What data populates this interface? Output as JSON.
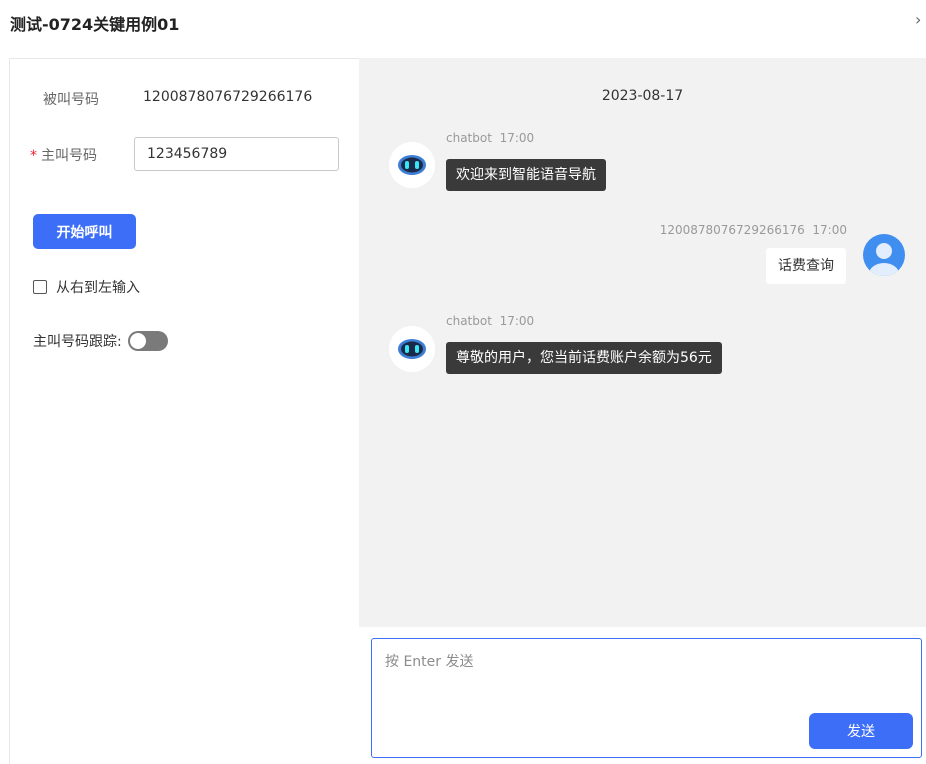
{
  "header": {
    "title": "测试-0724关键用例01",
    "close_icon": "›"
  },
  "form": {
    "callee_label": "被叫号码",
    "callee_value": "1200878076729266176",
    "caller_required_mark": "*",
    "caller_label": "主叫号码",
    "caller_value": "123456789",
    "start_button": "开始呼叫",
    "rtl_checkbox_label": "从右到左输入",
    "rtl_checked": false,
    "trace_label": "主叫号码跟踪:",
    "trace_enabled": false
  },
  "chat": {
    "date": "2023-08-17",
    "messages": [
      {
        "sender": "chatbot",
        "time": "17:00",
        "text": "欢迎来到智能语音导航",
        "side": "left"
      },
      {
        "sender": "1200878076729266176",
        "time": "17:00",
        "text": "话费查询",
        "side": "right"
      },
      {
        "sender": "chatbot",
        "time": "17:00",
        "text": "尊敬的用户，您当前话费账户余额为56元",
        "side": "left"
      }
    ]
  },
  "composer": {
    "placeholder": "按 Enter 发送",
    "send_button": "发送"
  },
  "colors": {
    "primary": "#3d6ef7",
    "bot_bubble": "#3a3a3a",
    "chat_bg": "#f2f2f2",
    "required": "#f5222d",
    "user_avatar": "#3f8ef0"
  },
  "icons": [
    "chevron-right-icon",
    "robot-avatar-icon",
    "user-avatar-icon",
    "checkbox-icon",
    "toggle-switch"
  ]
}
